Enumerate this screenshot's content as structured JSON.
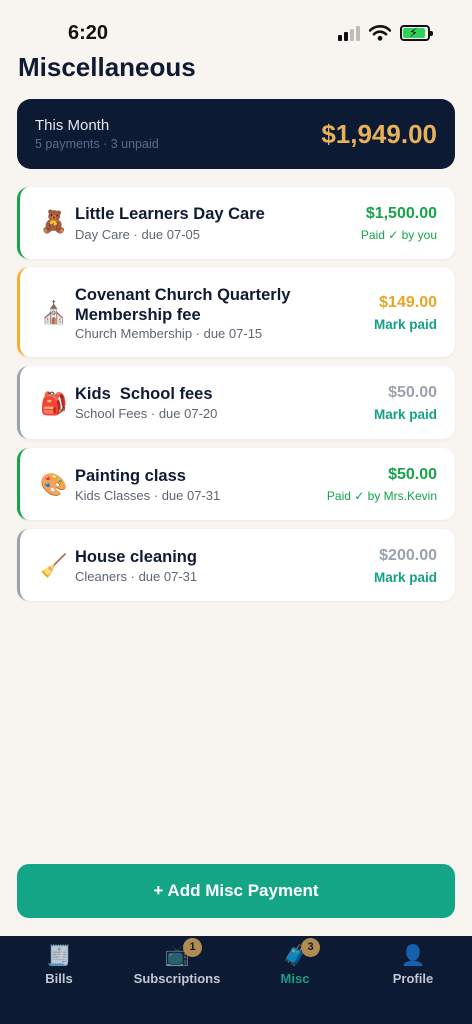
{
  "status_bar": {
    "time": "6:20"
  },
  "page": {
    "title": "Miscellaneous"
  },
  "summary": {
    "label": "This Month",
    "subtitle": "5 payments · 3 unpaid",
    "total": "$1,949.00"
  },
  "payments": [
    {
      "icon": "🧸",
      "title": "Little Learners Day Care",
      "subtitle": "Day Care · due 07-05",
      "amount": "$1,500.00",
      "status": "Paid ✓ by you",
      "accent": "#16a34a",
      "amount_color": "#16a34a"
    },
    {
      "icon": "⛪",
      "title": "Covenant Church Quarterly Membership fee",
      "subtitle": "Church Membership · due 07-15",
      "amount": "$149.00",
      "status": "Mark paid",
      "accent": "#f0b232",
      "amount_color": "#e8a526"
    },
    {
      "icon": "🎒",
      "title": "Kids  School fees",
      "subtitle": "School Fees · due 07-20",
      "amount": "$50.00",
      "status": "Mark paid",
      "accent": "#9aa2ae",
      "amount_color": "#9aa2ae"
    },
    {
      "icon": "🎨",
      "title": "Painting class",
      "subtitle": "Kids Classes · due 07-31",
      "amount": "$50.00",
      "status": "Paid ✓ by Mrs.Kevin",
      "accent": "#16a34a",
      "amount_color": "#16a34a"
    },
    {
      "icon": "🧹",
      "title": "House cleaning",
      "subtitle": "Cleaners · due 07-31",
      "amount": "$200.00",
      "status": "Mark paid",
      "accent": "#9aa2ae",
      "amount_color": "#9aa2ae"
    }
  ],
  "add_button": {
    "label": "+ Add Misc Payment"
  },
  "tabs": [
    {
      "label": "Bills",
      "icon": "🧾",
      "badge": ""
    },
    {
      "label": "Subscriptions",
      "icon": "📺",
      "badge": "1"
    },
    {
      "label": "Misc",
      "icon": "🧳",
      "badge": "3"
    },
    {
      "label": "Profile",
      "icon": "👤",
      "badge": ""
    }
  ],
  "colors": {
    "accent_teal": "#13a586",
    "navy": "#0d1a33",
    "gold": "#e8b15a",
    "paid_green": "#16a34a"
  }
}
